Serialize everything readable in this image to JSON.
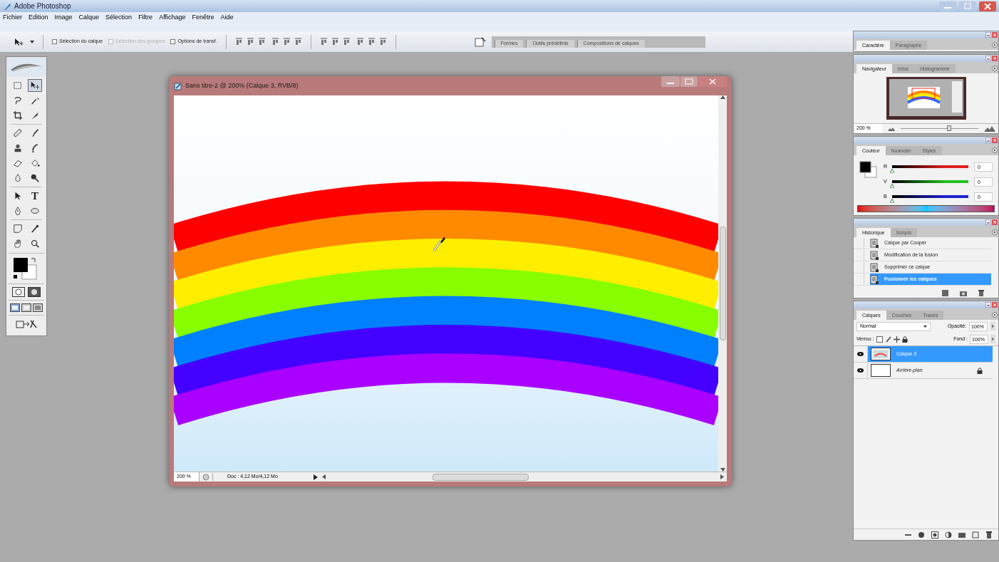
{
  "window": {
    "title": "Adobe Photoshop"
  },
  "menu": [
    "Fichier",
    "Edition",
    "Image",
    "Calque",
    "Sélection",
    "Filtre",
    "Affichage",
    "Fenêtre",
    "Aide"
  ],
  "options_bar": {
    "checkboxes": [
      {
        "label": "Sélection du calque",
        "checked": false,
        "disabled": false
      },
      {
        "label": "Sélection des groupes",
        "checked": false,
        "disabled": true
      },
      {
        "label": "Options de transf.",
        "checked": false,
        "disabled": false
      }
    ],
    "palette_well_tabs": [
      "Formes",
      "Outils prédéfinis",
      "Compositions de calques"
    ]
  },
  "toolbox": {
    "tools": [
      {
        "kind": "marquee",
        "selected": false
      },
      {
        "kind": "move",
        "selected": true
      },
      {
        "kind": "lasso",
        "selected": false
      },
      {
        "kind": "wand",
        "selected": false
      },
      {
        "kind": "crop",
        "selected": false
      },
      {
        "kind": "slice",
        "selected": false
      },
      {
        "kind": "bandage",
        "selected": false
      },
      {
        "kind": "brush",
        "selected": false
      },
      {
        "kind": "stamp",
        "selected": false
      },
      {
        "kind": "history",
        "selected": false
      },
      {
        "kind": "eraser",
        "selected": false
      },
      {
        "kind": "bucket",
        "selected": false
      },
      {
        "kind": "drop",
        "selected": false
      },
      {
        "kind": "dodge",
        "selected": false
      },
      {
        "kind": "pathselect",
        "selected": false
      },
      {
        "kind": "type",
        "glyph": "T",
        "selected": false
      },
      {
        "kind": "pen",
        "selected": false
      },
      {
        "kind": "shape",
        "selected": false
      },
      {
        "kind": "notes",
        "selected": false
      },
      {
        "kind": "eyedropper",
        "selected": false
      },
      {
        "kind": "hand",
        "selected": false
      },
      {
        "kind": "zoom",
        "selected": false
      }
    ]
  },
  "document": {
    "title": "Sans titre-2 @ 200% (Calque 3, RVB/8)",
    "zoom": "200 %",
    "doc_info": "Doc : 4,12 Mo/4,12 Mo"
  },
  "character_panel": {
    "tabs": [
      {
        "label": "Caractère",
        "selected": true
      },
      {
        "label": "Paragraphe",
        "selected": false
      }
    ]
  },
  "navigator_panel": {
    "tabs": [
      {
        "label": "Navigateur",
        "selected": true
      },
      {
        "label": "Infos",
        "selected": false
      },
      {
        "label": "Histogramme",
        "selected": false
      }
    ],
    "zoom": "200 %",
    "level": 0.62
  },
  "color_panel": {
    "tabs": [
      {
        "label": "Couleur",
        "selected": true
      },
      {
        "label": "Nuancier",
        "selected": false
      },
      {
        "label": "Styles",
        "selected": false
      }
    ],
    "channels": [
      {
        "label": "R",
        "value": "0",
        "level": 0,
        "color": "#e02020"
      },
      {
        "label": "V",
        "value": "0",
        "level": 0,
        "color": "#20c020"
      },
      {
        "label": "B",
        "value": "0",
        "level": 0,
        "color": "#2020d0"
      }
    ]
  },
  "history_panel": {
    "tabs": [
      {
        "label": "Historique",
        "selected": true
      },
      {
        "label": "Scripts",
        "selected": false
      }
    ],
    "items": [
      {
        "label": "Calque par Couper",
        "selected": false
      },
      {
        "label": "Modification de la fusion",
        "selected": false
      },
      {
        "label": "Supprimer ce calque",
        "selected": false
      },
      {
        "label": "Fusionner les calques",
        "selected": true
      }
    ]
  },
  "layers_panel": {
    "tabs": [
      {
        "label": "Calques",
        "selected": true
      },
      {
        "label": "Couches",
        "selected": false
      },
      {
        "label": "Tracés",
        "selected": false
      }
    ],
    "blend_mode": "Normal",
    "opacity_label": "Opacité:",
    "opacity": "100%",
    "lock_label": "Verrou :",
    "fill_label": "Fond :",
    "fill": "100%",
    "layers": [
      {
        "name": "Calque 3",
        "selected": true,
        "visible": true,
        "locked": false,
        "italic": false
      },
      {
        "name": "Arrière-plan",
        "selected": false,
        "visible": true,
        "locked": true,
        "italic": true
      }
    ]
  }
}
